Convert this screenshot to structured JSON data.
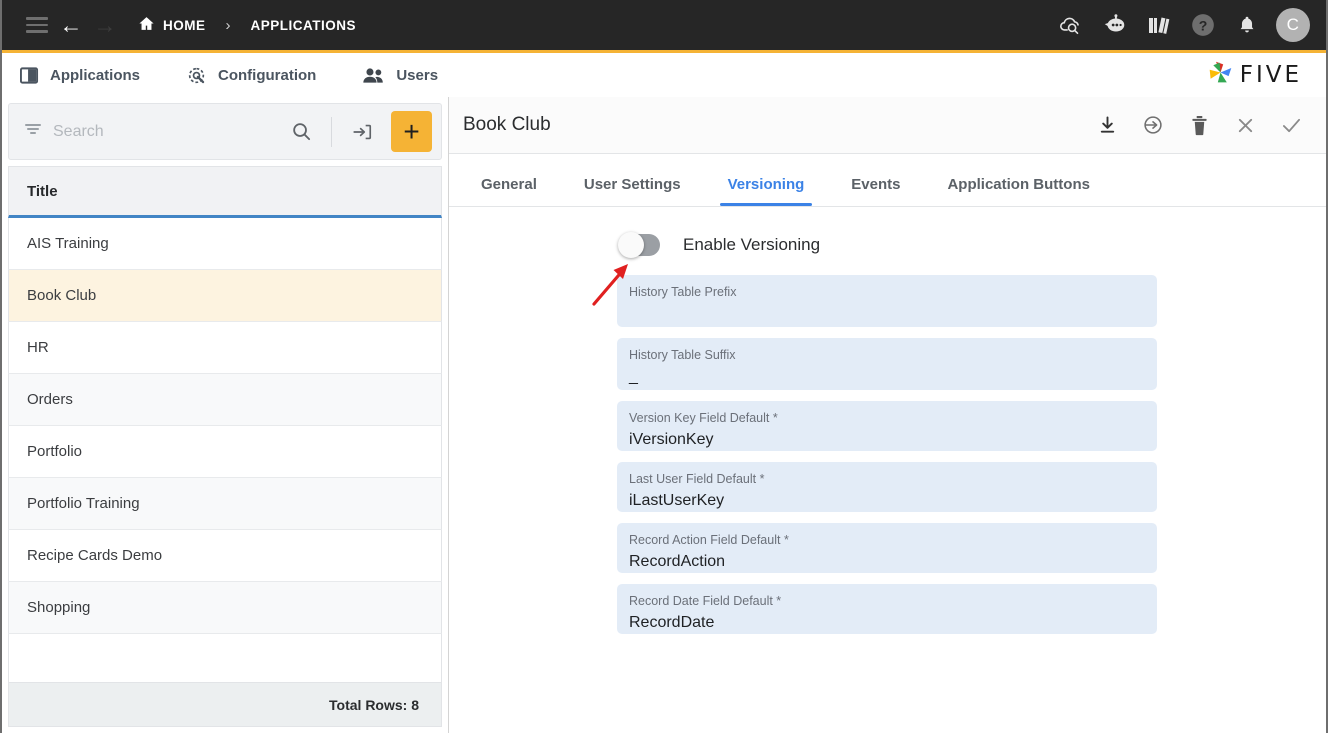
{
  "topbar": {
    "menu_icon": "hamburger-icon",
    "back_icon": "arrow-back-icon",
    "forward_icon": "arrow-forward-icon",
    "home_label": "HOME",
    "separator": "›",
    "current_label": "APPLICATIONS",
    "right_icons": [
      {
        "name": "cloud-search-icon"
      },
      {
        "name": "chat-bot-icon"
      },
      {
        "name": "books-library-icon"
      },
      {
        "name": "help-icon"
      },
      {
        "name": "notifications-bell-icon"
      }
    ],
    "avatar_initial": "C",
    "accent_color": "#f5b335",
    "background_color": "#262626"
  },
  "navrow": {
    "items": [
      {
        "label": "Applications",
        "icon": "panel-layout-icon"
      },
      {
        "label": "Configuration",
        "icon": "gear-wrench-icon"
      },
      {
        "label": "Users",
        "icon": "users-icon"
      }
    ],
    "brand": {
      "label": "FIVE",
      "icon": "five-pinwheel-logo-icon"
    }
  },
  "sidebar": {
    "search": {
      "placeholder": "Search",
      "value": "",
      "filter_icon": "filter-icon",
      "search_icon": "search-icon",
      "import_icon": "import-arrow-icon",
      "add_label": "+"
    },
    "column_header": "Title",
    "rows": [
      {
        "title": "AIS Training"
      },
      {
        "title": "Book Club"
      },
      {
        "title": "HR"
      },
      {
        "title": "Orders"
      },
      {
        "title": "Portfolio"
      },
      {
        "title": "Portfolio Training"
      },
      {
        "title": "Recipe Cards Demo"
      },
      {
        "title": "Shopping"
      }
    ],
    "selected_index": 1,
    "total_rows_label": "Total Rows: 8",
    "selected_color": "#fdf3e0",
    "header_underline_color": "#4285c5"
  },
  "panel": {
    "title": "Book Club",
    "actions": [
      {
        "name": "download-icon"
      },
      {
        "name": "export-circle-arrow-icon"
      },
      {
        "name": "delete-trash-icon"
      },
      {
        "name": "close-x-icon"
      },
      {
        "name": "save-check-icon"
      }
    ],
    "tabs": [
      {
        "label": "General",
        "active": false
      },
      {
        "label": "User Settings",
        "active": false
      },
      {
        "label": "Versioning",
        "active": true
      },
      {
        "label": "Events",
        "active": false
      },
      {
        "label": "Application Buttons",
        "active": false
      }
    ],
    "active_tab_color": "#3b82e6"
  },
  "form": {
    "toggle": {
      "label": "Enable Versioning",
      "enabled": false
    },
    "fields": [
      {
        "label": "History Table Prefix",
        "value": ""
      },
      {
        "label": "History Table Suffix",
        "value": "_"
      },
      {
        "label": "Version Key Field Default *",
        "value": "iVersionKey"
      },
      {
        "label": "Last User Field Default *",
        "value": "iLastUserKey"
      },
      {
        "label": "Record Action Field Default *",
        "value": "RecordAction"
      },
      {
        "label": "Record Date Field Default *",
        "value": "RecordDate"
      }
    ],
    "field_background": "#e3ecf7"
  },
  "annotation": {
    "name": "red-arrow-annotation",
    "color": "#e02020"
  }
}
